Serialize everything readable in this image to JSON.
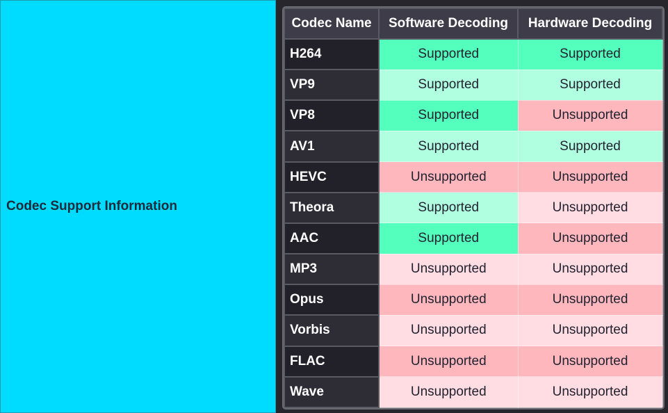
{
  "left_panel": {
    "title": "Codec Support Information"
  },
  "colors": {
    "left_panel_bg": "#00dcff",
    "supported_strong": "#54ffbd",
    "supported_light": "#b1ffe1",
    "unsupported_strong": "#ffb7be",
    "unsupported_light": "#ffdde2",
    "header_bg": "#3d3c48"
  },
  "table": {
    "headers": [
      "Codec Name",
      "Software Decoding",
      "Hardware Decoding"
    ],
    "rows": [
      {
        "codec": "H264",
        "software": "Supported",
        "hardware": "Supported"
      },
      {
        "codec": "VP9",
        "software": "Supported",
        "hardware": "Supported"
      },
      {
        "codec": "VP8",
        "software": "Supported",
        "hardware": "Unsupported"
      },
      {
        "codec": "AV1",
        "software": "Supported",
        "hardware": "Supported"
      },
      {
        "codec": "HEVC",
        "software": "Unsupported",
        "hardware": "Unsupported"
      },
      {
        "codec": "Theora",
        "software": "Supported",
        "hardware": "Unsupported"
      },
      {
        "codec": "AAC",
        "software": "Supported",
        "hardware": "Unsupported"
      },
      {
        "codec": "MP3",
        "software": "Unsupported",
        "hardware": "Unsupported"
      },
      {
        "codec": "Opus",
        "software": "Unsupported",
        "hardware": "Unsupported"
      },
      {
        "codec": "Vorbis",
        "software": "Unsupported",
        "hardware": "Unsupported"
      },
      {
        "codec": "FLAC",
        "software": "Unsupported",
        "hardware": "Unsupported"
      },
      {
        "codec": "Wave",
        "software": "Unsupported",
        "hardware": "Unsupported"
      }
    ]
  }
}
